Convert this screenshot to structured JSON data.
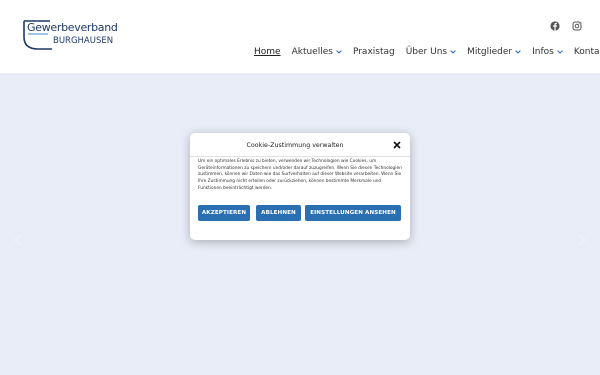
{
  "logo": {
    "line1": "Gewerbeverband",
    "line2": "BURGHAUSEN"
  },
  "social": {
    "facebook_icon": "facebook-icon",
    "instagram_icon": "instagram-icon"
  },
  "nav": {
    "items": [
      {
        "label": "Home",
        "active": true,
        "dropdown": false
      },
      {
        "label": "Aktuelles",
        "active": false,
        "dropdown": true
      },
      {
        "label": "Praxistag",
        "active": false,
        "dropdown": false
      },
      {
        "label": "Über Uns",
        "active": false,
        "dropdown": true
      },
      {
        "label": "Mitglieder",
        "active": false,
        "dropdown": true
      },
      {
        "label": "Infos",
        "active": false,
        "dropdown": true
      },
      {
        "label": "Kontakt",
        "active": false,
        "dropdown": false
      }
    ]
  },
  "colors": {
    "brand": "#1f3a66",
    "accent": "#2b6fb3",
    "page_bg": "#e9edf7"
  },
  "cookie_modal": {
    "title": "Cookie-Zustimmung verwalten",
    "text": "Um ein optimales Erlebnis zu bieten, verwenden wir Technologien wie Cookies, um Geräteinformationen zu speichern und/oder darauf zuzugreifen. Wenn Sie diesen Technologien zustimmen, können wir Daten wie das Surfverhalten auf dieser Website verarbeiten. Wenn Sie Ihre Zustimmung nicht erteilen oder zurückziehen, können bestimmte Merkmale und Funktionen beeinträchtigt werden.",
    "accept_label": "AKZEPTIEREN",
    "deny_label": "ABLEHNEN",
    "settings_label": "EINSTELLUNGEN ANSEHEN"
  }
}
